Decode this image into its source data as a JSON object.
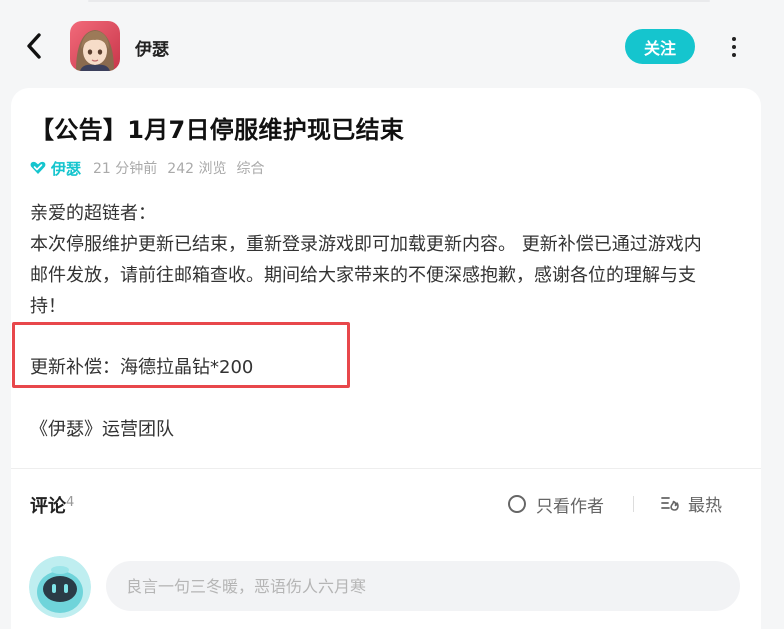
{
  "header": {
    "author_name": "伊瑟",
    "follow_label": "关注"
  },
  "post": {
    "title": "【公告】1月7日停服维护现已结束",
    "meta": {
      "verified_name": "伊瑟",
      "time": "21 分钟前",
      "views": "242 浏览",
      "category": "综合"
    },
    "body_lines": [
      "亲爱的超链者：",
      "本次停服维护更新已结束，重新登录游戏即可加载更新内容。 更新补偿已通过游戏内",
      "邮件发放，请前往邮箱查收。期间给大家带来的不便深感抱歉，感谢各位的理解与支",
      "持！"
    ],
    "compensation": "更新补偿：海德拉晶钻*200",
    "signature": "《伊瑟》运营团队"
  },
  "comments": {
    "label": "评论",
    "count": "4",
    "only_author_label": "只看作者",
    "sort_label": "最热",
    "input_placeholder": "良言一句三冬暖，恶语伤人六月寒"
  },
  "colors": {
    "accent": "#15c5ce",
    "highlight_border": "#e8474b",
    "background": "#f5f6f7"
  }
}
